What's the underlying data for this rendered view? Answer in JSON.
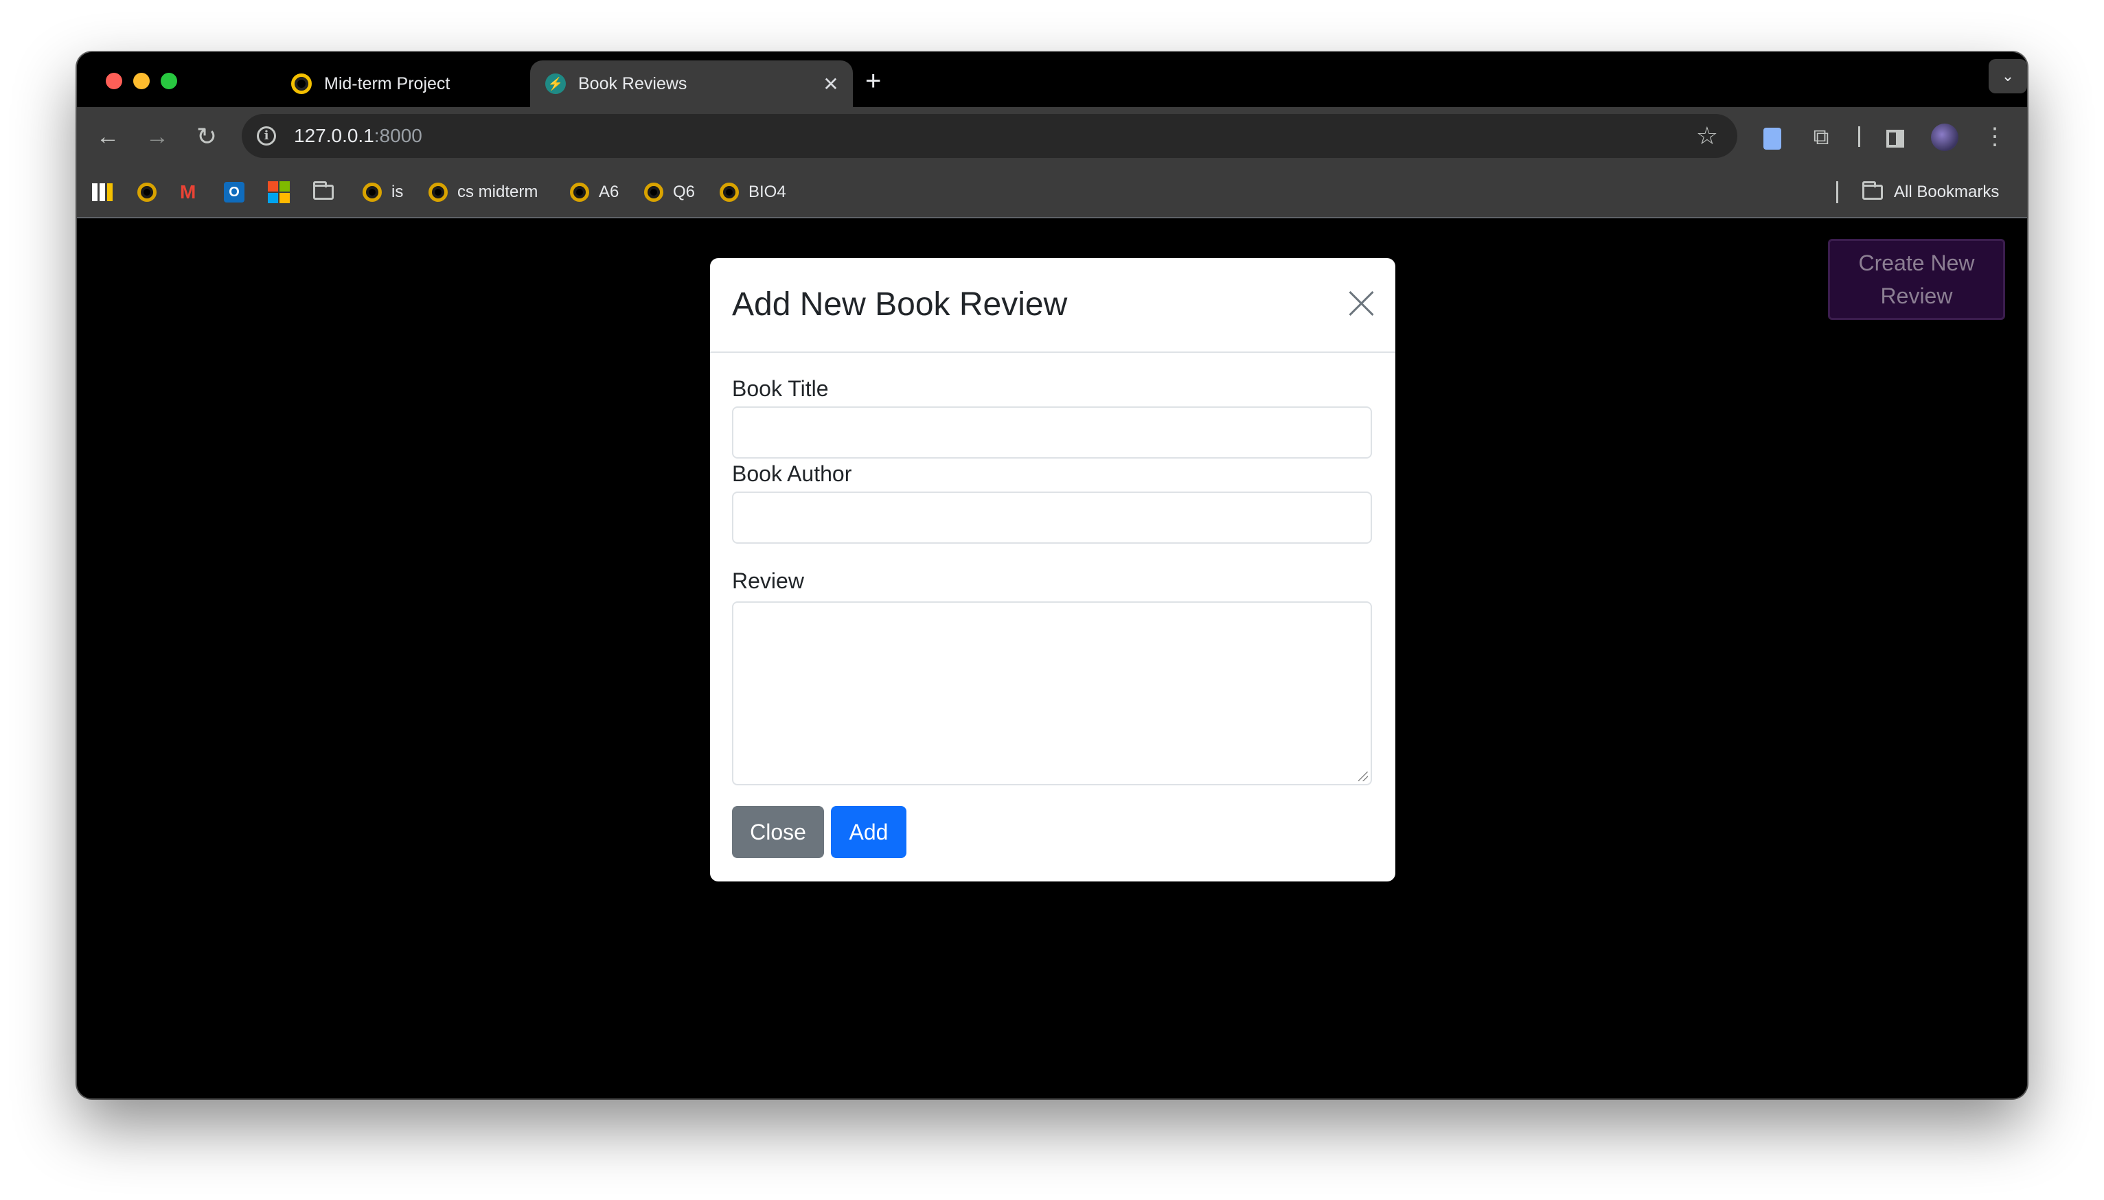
{
  "browser": {
    "tabs": [
      {
        "title": "Mid-term Project",
        "active": false
      },
      {
        "title": "Book Reviews",
        "active": true
      }
    ],
    "new_tab_glyph": "+",
    "tab_close_glyph": "✕",
    "tab_search_glyph": "⌄",
    "url": {
      "host": "127.0.0.1",
      "port": ":8000"
    },
    "nav": {
      "back_glyph": "←",
      "forward_glyph": "→",
      "reload_glyph": "↻",
      "star_glyph": "☆",
      "menu_glyph": "⋮",
      "puzzle_glyph": "⧉"
    }
  },
  "bookmarks": {
    "items": [
      {
        "label": "is"
      },
      {
        "label": "cs midterm"
      },
      {
        "label": "A6"
      },
      {
        "label": "Q6"
      },
      {
        "label": "BIO4"
      }
    ],
    "gmail_glyph": "M",
    "outlook_glyph": "O",
    "all_bookmarks_label": "All Bookmarks"
  },
  "page": {
    "create_button_label": "Create New Review",
    "accent_color": "#250a36"
  },
  "modal": {
    "title": "Add New Book Review",
    "fields": {
      "book_title_label": "Book Title",
      "book_title_value": "",
      "book_author_label": "Book Author",
      "book_author_value": "",
      "review_label": "Review",
      "review_value": ""
    },
    "close_button_label": "Close",
    "add_button_label": "Add",
    "colors": {
      "primary": "#0d6efd",
      "secondary": "#6c757d"
    }
  }
}
